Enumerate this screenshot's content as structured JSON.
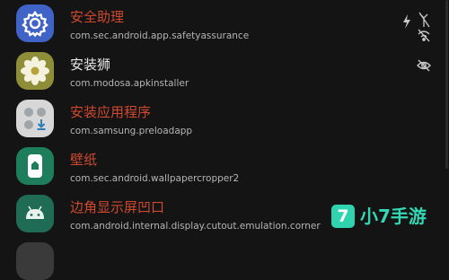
{
  "apps": [
    {
      "title": "安全助理",
      "package": "com.sec.android.app.safetyassurance",
      "title_color": "#d0492f",
      "icon": "gear-icon"
    },
    {
      "title": "安装狮",
      "package": "com.modosa.apkinstaller",
      "title_color": "#e8e8e8",
      "icon": "flower-icon"
    },
    {
      "title": "安装应用程序",
      "package": "com.samsung.preloadapp",
      "title_color": "#d0492f",
      "icon": "app-grid-download-icon"
    },
    {
      "title": "壁纸",
      "package": "com.sec.android.wallpapercropper2",
      "title_color": "#d0492f",
      "icon": "wallpaper-icon"
    },
    {
      "title": "边角显示屏凹口",
      "package": "com.android.internal.display.cutout.emulation.corner",
      "title_color": "#d0492f",
      "icon": "android-icon"
    }
  ],
  "watermark": {
    "badge": "7",
    "text": "小7手游"
  },
  "colors": {
    "background": "#141414",
    "disabled_title": "#d0492f",
    "watermark": "#2fd3ae"
  }
}
